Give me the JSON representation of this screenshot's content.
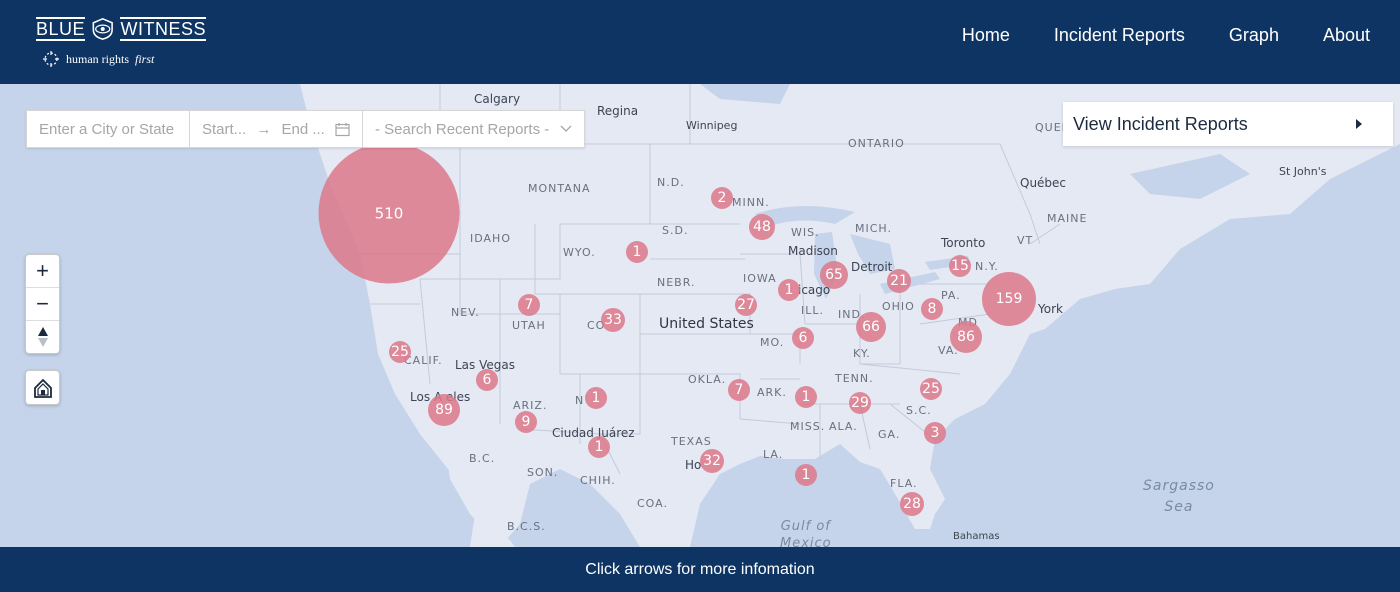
{
  "header": {
    "logo_left": "BLUE",
    "logo_right": "WITNESS",
    "logo_sub": "human rights",
    "logo_sub_italic": "first",
    "nav": [
      "Home",
      "Incident Reports",
      "Graph",
      "About"
    ]
  },
  "search": {
    "city_placeholder": "Enter a City or State",
    "start_placeholder": "Start...",
    "arrow": "→",
    "end_placeholder": "End ...",
    "recent_placeholder": "- Search Recent Reports -"
  },
  "incident_panel": {
    "label": "View Incident Reports"
  },
  "zoom": {
    "in": "+",
    "out": "−"
  },
  "map_labels": {
    "calgary": "Calgary",
    "regina": "Regina",
    "winnipeg": "Winnipeg",
    "ontario": "ONTARIO",
    "quebec_prov": "QUEBEC",
    "montana": "MONTANA",
    "nd": "N.D.",
    "minn": "MINN.",
    "idaho": "IDAHO",
    "sd": "S.D.",
    "wis": "WIS.",
    "mich": "MICH.",
    "wyo": "WYO.",
    "madison": "Madison",
    "toronto": "Toronto",
    "quebec": "Québec",
    "maine": "MAINE",
    "stjohns": "St John's",
    "nebr": "NEBR.",
    "iowa": "IOWA",
    "detroit": "Detroit",
    "ny": "N.Y.",
    "nev": "NEV.",
    "utah": "UTAH",
    "colo": "CO",
    "chicago": "icago",
    "ill": "ILL.",
    "ohio": "OHIO",
    "pa": "PA.",
    "ind": "IND.",
    "newyork": "York",
    "united_states": "United States",
    "mo": "MO.",
    "ky": "KY.",
    "va": "VA.",
    "calif": "CALIF.",
    "lasvegas": "Las Vegas",
    "okla": "OKLA.",
    "ark": "ARK.",
    "tenn": "TENN.",
    "losangeles": "Los A    eles",
    "ariz": "ARIZ.",
    "sc": "S.C.",
    "miss": "MISS.",
    "ala": "ALA.",
    "ga": "GA.",
    "ciudad": "Ciudad Juárez",
    "texas": "TEXAS",
    "houston": "Ho",
    "la": "LA.",
    "bc": "B.C.",
    "son": "SON.",
    "chih": "CHIH.",
    "coa": "COA.",
    "fla": "FLA.",
    "bcs": "B.C.S.",
    "gulf": "Gulf of\nMexico",
    "sargasso": "Sargasso\nSea",
    "bahamas": "Bahamas",
    "nm": "N",
    "vt": "VT",
    "md": "MD"
  },
  "clusters": [
    {
      "id": "west",
      "count": "510"
    },
    {
      "id": "mn-n",
      "count": "2"
    },
    {
      "id": "wi",
      "count": "48"
    },
    {
      "id": "wy",
      "count": "1"
    },
    {
      "id": "chicago",
      "count": "65"
    },
    {
      "id": "detroit",
      "count": "21"
    },
    {
      "id": "upny",
      "count": "15"
    },
    {
      "id": "nyc",
      "count": "159"
    },
    {
      "id": "ut",
      "count": "7"
    },
    {
      "id": "co",
      "count": "33"
    },
    {
      "id": "ia",
      "count": "27"
    },
    {
      "id": "il",
      "count": "1"
    },
    {
      "id": "pa",
      "count": "8"
    },
    {
      "id": "in",
      "count": "66"
    },
    {
      "id": "va",
      "count": "86"
    },
    {
      "id": "mo",
      "count": "6"
    },
    {
      "id": "sf",
      "count": "25"
    },
    {
      "id": "lv",
      "count": "6"
    },
    {
      "id": "ok",
      "count": "7"
    },
    {
      "id": "ar",
      "count": "1"
    },
    {
      "id": "nc",
      "count": "25"
    },
    {
      "id": "la-ca",
      "count": "89"
    },
    {
      "id": "nm",
      "count": "1"
    },
    {
      "id": "ga",
      "count": "29"
    },
    {
      "id": "az",
      "count": "9"
    },
    {
      "id": "elpaso",
      "count": "1"
    },
    {
      "id": "sc",
      "count": "3"
    },
    {
      "id": "hou",
      "count": "32"
    },
    {
      "id": "nola",
      "count": "1"
    },
    {
      "id": "fl",
      "count": "28"
    }
  ],
  "footer": {
    "text": "Click arrows for more infomation"
  },
  "colors": {
    "navy": "#0e3463",
    "cluster": "#dc788a",
    "land": "#e4e9f4",
    "water": "#c5d4ea"
  }
}
